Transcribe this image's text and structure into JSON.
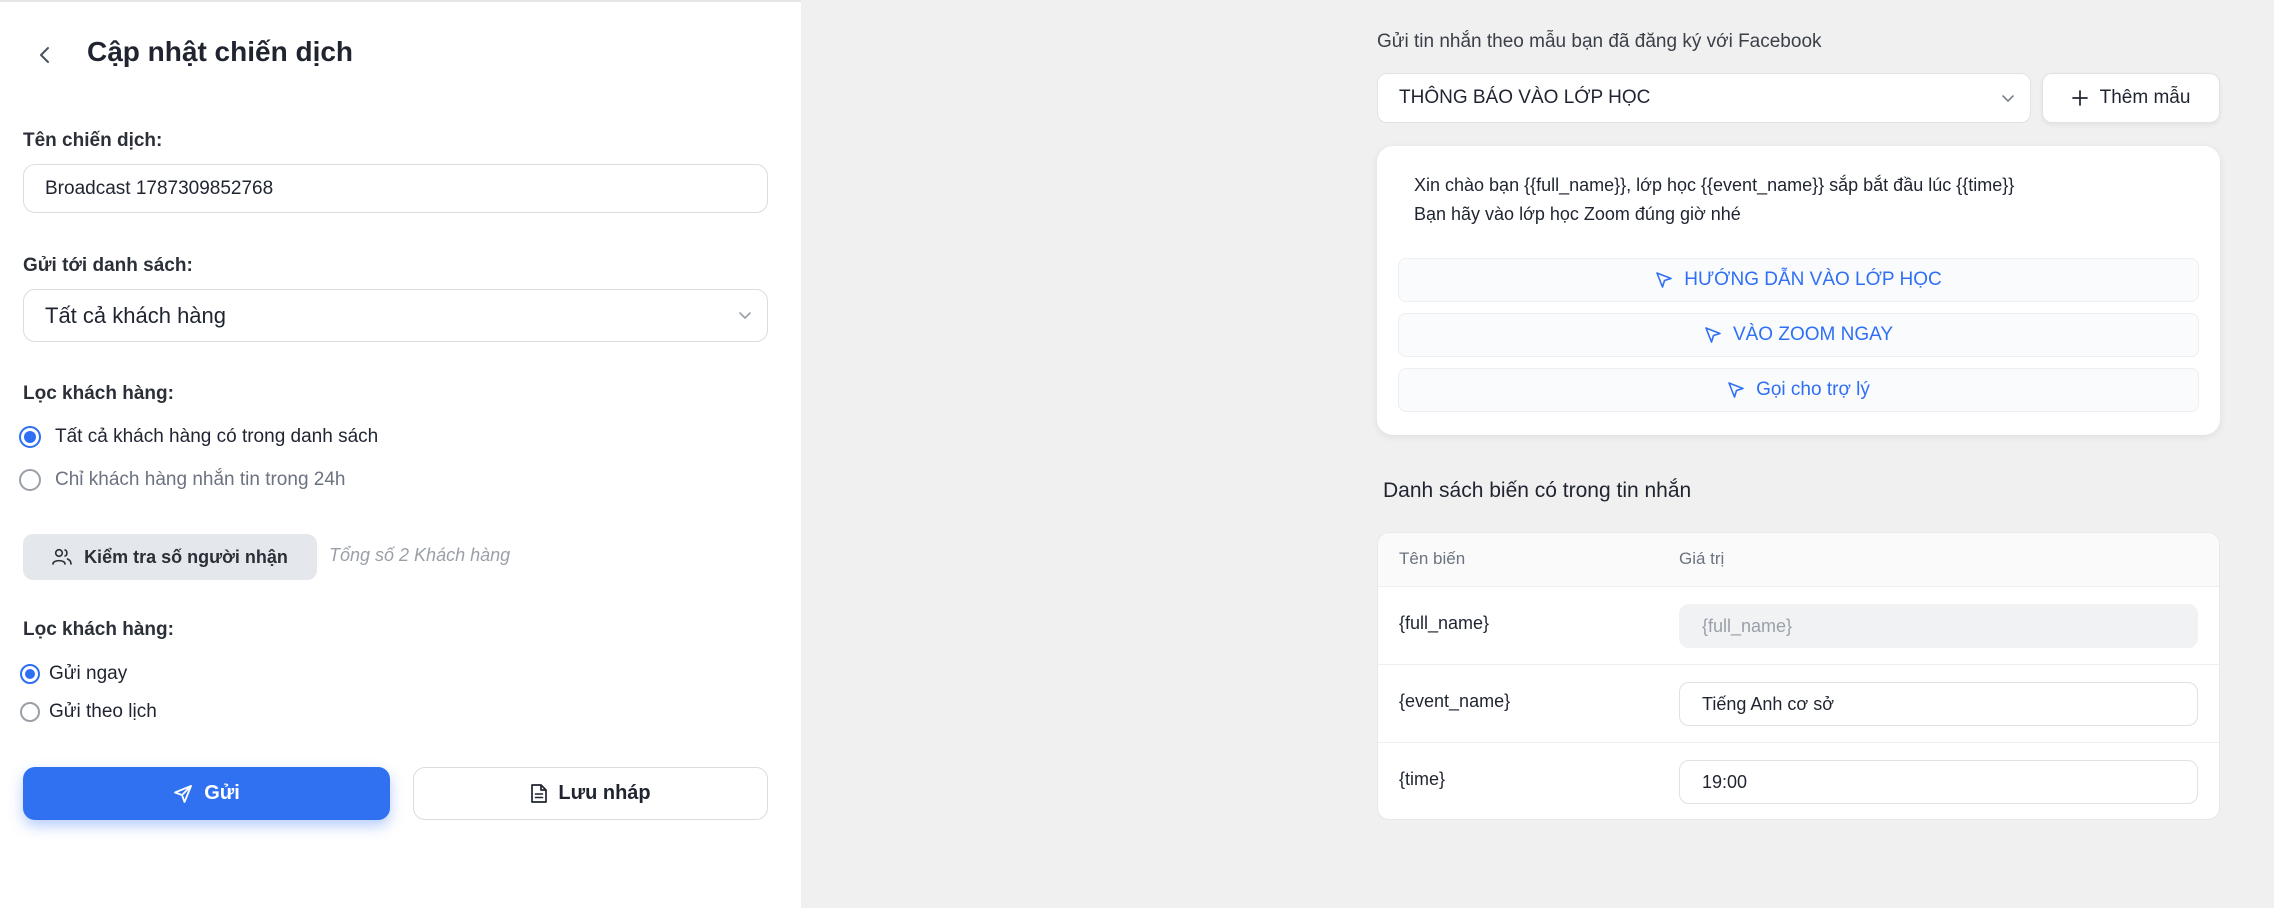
{
  "header": {
    "title": "Cập nhật chiến dịch"
  },
  "campaign": {
    "name_label": "Tên chiến dịch:",
    "name_value": "Broadcast 1787309852768"
  },
  "send_list": {
    "label": "Gửi tới danh sách:",
    "selected": "Tất cả khách hàng"
  },
  "filter": {
    "label": "Lọc khách hàng:",
    "options": [
      "Tất cả khách hàng có trong danh sách",
      "Chỉ khách hàng nhắn tin trong 24h"
    ],
    "selected_index": 0
  },
  "recipients": {
    "check_label": "Kiểm tra số người nhận",
    "total_text": "Tổng số 2 Khách hàng"
  },
  "schedule": {
    "label": "Lọc khách hàng:",
    "options": [
      "Gửi ngay",
      "Gửi theo lịch"
    ],
    "selected_index": 0
  },
  "actions": {
    "send_label": "Gửi",
    "draft_label": "Lưu nháp"
  },
  "template": {
    "section_title": "Gửi tin nhắn theo mẫu bạn đã đăng ký với Facebook",
    "selected": "THÔNG BÁO VÀO LỚP HỌC",
    "add_label": "Thêm mẫu",
    "message_lines": [
      "Xin chào bạn {{full_name}}, lớp học {{event_name}} sắp bắt đầu lúc {{time}}",
      "Bạn hãy vào lớp học Zoom đúng giờ nhé"
    ],
    "buttons": [
      "HƯỚNG DẪN VÀO LỚP HỌC",
      "VÀO ZOOM NGAY",
      "Gọi cho trợ lý"
    ]
  },
  "variables": {
    "title": "Danh sách biến có trong tin nhắn",
    "col_name": "Tên biến",
    "col_value": "Giá trị",
    "rows": [
      {
        "name": "{full_name}",
        "value": "{full_name}",
        "disabled": true
      },
      {
        "name": "{event_name}",
        "value": "Tiếng Anh cơ sở",
        "disabled": false
      },
      {
        "name": "{time}",
        "value": "19:00",
        "disabled": false
      }
    ]
  },
  "colors": {
    "accent": "#3071f2",
    "panel_bg": "#f0f0f0",
    "link": "#2f6ff5"
  }
}
